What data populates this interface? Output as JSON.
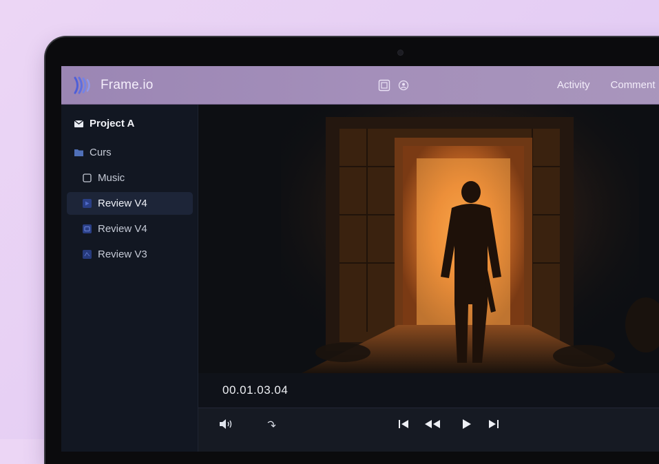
{
  "app": {
    "brand": "Frame.io"
  },
  "header": {
    "nav": [
      "Activity",
      "Comment"
    ]
  },
  "sidebar": {
    "items": [
      {
        "label": "Project A",
        "icon": "envelope-icon"
      },
      {
        "label": "Curs",
        "icon": "folder-icon"
      },
      {
        "label": "Music",
        "icon": "square-icon"
      },
      {
        "label": "Review V4",
        "icon": "video-file-icon",
        "active": true
      },
      {
        "label": "Review V4",
        "icon": "video-file-icon"
      },
      {
        "label": "Review V3",
        "icon": "video-file-icon"
      }
    ]
  },
  "player": {
    "timecode": "00.01.03.04"
  },
  "colors": {
    "accent": "#a48fba",
    "background": "#12151d",
    "active_item": "#1d2538"
  }
}
